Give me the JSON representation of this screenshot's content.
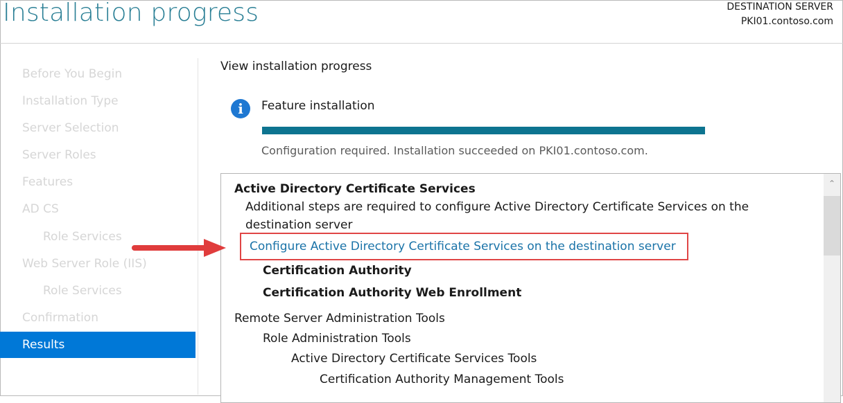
{
  "window": {
    "title": "Installation progress",
    "destination_label": "DESTINATION SERVER",
    "destination_server": "PKI01.contoso.com"
  },
  "nav": {
    "items": [
      {
        "label": "Before You Begin",
        "sub": false,
        "active": false
      },
      {
        "label": "Installation Type",
        "sub": false,
        "active": false
      },
      {
        "label": "Server Selection",
        "sub": false,
        "active": false
      },
      {
        "label": "Server Roles",
        "sub": false,
        "active": false
      },
      {
        "label": "Features",
        "sub": false,
        "active": false
      },
      {
        "label": "AD CS",
        "sub": false,
        "active": false
      },
      {
        "label": "Role Services",
        "sub": true,
        "active": false
      },
      {
        "label": "Web Server Role (IIS)",
        "sub": false,
        "active": false
      },
      {
        "label": "Role Services",
        "sub": true,
        "active": false
      },
      {
        "label": "Confirmation",
        "sub": false,
        "active": false
      },
      {
        "label": "Results",
        "sub": false,
        "active": true
      }
    ]
  },
  "main": {
    "heading": "View installation progress",
    "feature_label": "Feature installation",
    "progress_value": 1.0,
    "status_text": "Configuration required. Installation succeeded on PKI01.contoso.com.",
    "info_icon": "info-icon",
    "results": {
      "adcs_title": "Active Directory Certificate Services",
      "adcs_note_line1": "Additional steps are required to configure Active Directory Certificate Services on the",
      "adcs_note_line2": "destination server",
      "configure_link": "Configure Active Directory Certificate Services on the destination server",
      "role_ca": "Certification Authority",
      "role_web_enrollment": "Certification Authority Web Enrollment",
      "rsat": "Remote Server Administration Tools",
      "role_admin_tools": "Role Administration Tools",
      "adcs_tools": "Active Directory Certificate Services Tools",
      "ca_mgmt_tools": "Certification Authority Management Tools"
    }
  },
  "colors": {
    "accent": "#0078d7",
    "title": "#2a7f95",
    "progress": "#0d7490",
    "callout": "#e04545",
    "link": "#1a73a8"
  }
}
